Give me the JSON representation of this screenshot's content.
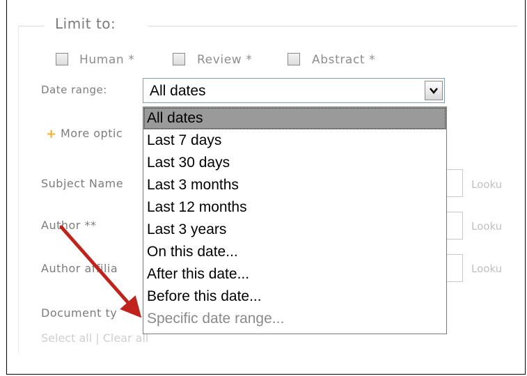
{
  "limit_to": {
    "legend": "Limit to:",
    "checkboxes": [
      {
        "label": "Human *",
        "checked": false
      },
      {
        "label": "Review *",
        "checked": false
      },
      {
        "label": "Abstract *",
        "checked": false
      }
    ]
  },
  "date_range": {
    "label": "Date range:",
    "selected": "All dates",
    "options": [
      "All dates",
      "Last 7 days",
      "Last 30 days",
      "Last 3 months",
      "Last 12 months",
      "Last 3 years",
      "On this date...",
      "After this date...",
      "Before this date...",
      "Specific date range..."
    ]
  },
  "more_options": "More optic",
  "fields": {
    "subject_name": "Subject Name",
    "author": "Author **",
    "author_affiliation": "Author affilia",
    "document_type": "Document ty",
    "lookup": "Looku"
  },
  "select_links": "Select all | Clear all",
  "colors": {
    "arrow": "#c0231c",
    "selected_option_bg": "#9a9a9a",
    "accent_plus": "#f0b030"
  }
}
